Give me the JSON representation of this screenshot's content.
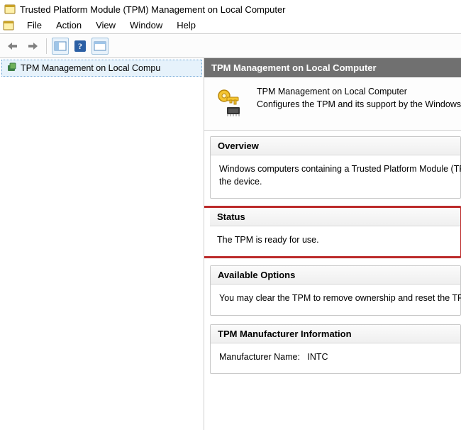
{
  "window": {
    "title": "Trusted Platform Module (TPM) Management on Local Computer"
  },
  "menu": {
    "items": [
      "File",
      "Action",
      "View",
      "Window",
      "Help"
    ]
  },
  "tree": {
    "selected_label": "TPM Management on Local Compu"
  },
  "content": {
    "header": "TPM Management on Local Computer",
    "intro_line1": "TPM Management on Local Computer",
    "intro_line2": "Configures the TPM and its support by the Windows plat"
  },
  "panels": {
    "overview": {
      "title": "Overview",
      "body_line1": "Windows computers containing a Trusted Platform Module (TPM)",
      "body_line2": "the device."
    },
    "status": {
      "title": "Status",
      "body": "The TPM is ready for use."
    },
    "options": {
      "title": "Available Options",
      "body": "You may clear the TPM to remove ownership and reset the TPM"
    },
    "manufacturer": {
      "title": "TPM Manufacturer Information",
      "label": "Manufacturer Name:",
      "value": "INTC"
    }
  }
}
